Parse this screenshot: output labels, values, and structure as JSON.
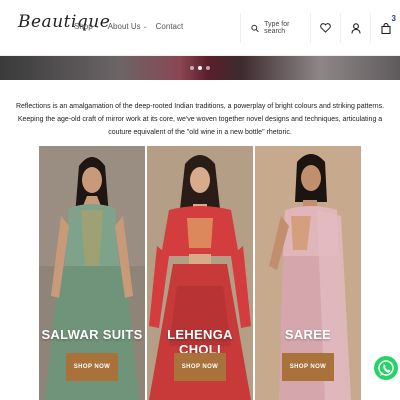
{
  "header": {
    "logo_text": "Beautique",
    "nav": [
      {
        "label": "Shop",
        "has_dropdown": true
      },
      {
        "label": "About Us",
        "has_dropdown": true
      },
      {
        "label": "Contact",
        "has_dropdown": false
      }
    ],
    "search_placeholder": "Type for search",
    "cart_count": "3",
    "icons": [
      "search-icon",
      "heart-icon",
      "user-icon",
      "bag-icon"
    ]
  },
  "slider": {
    "dots": 3,
    "active_dot": 2
  },
  "intro_text": "Reflections is an amalgamation of the deep-rooted Indian traditions, a powerplay of bright colours and striking patterns. Keeping the age-old craft of mirror work at its core, we've woven together novel designs and techniques, articulating a couture equivalent of the \"old wine in a new bottle\" rhetoric.",
  "categories": [
    {
      "label": "SALWAR SUITS",
      "button": "SHOP NOW",
      "bg": "#8f8478",
      "garment": "#7fa38a"
    },
    {
      "label": "LEHENGA CHOLI",
      "button": "SHOP NOW",
      "bg": "#b59e86",
      "garment": "#c83a3a"
    },
    {
      "label": "SAREE",
      "button": "SHOP NOW",
      "bg": "#c7a98e",
      "garment": "#d6a6ad"
    }
  ],
  "colors": {
    "accent": "#a8723a",
    "badge": "#1a3fa6",
    "whatsapp": "#25d366"
  }
}
